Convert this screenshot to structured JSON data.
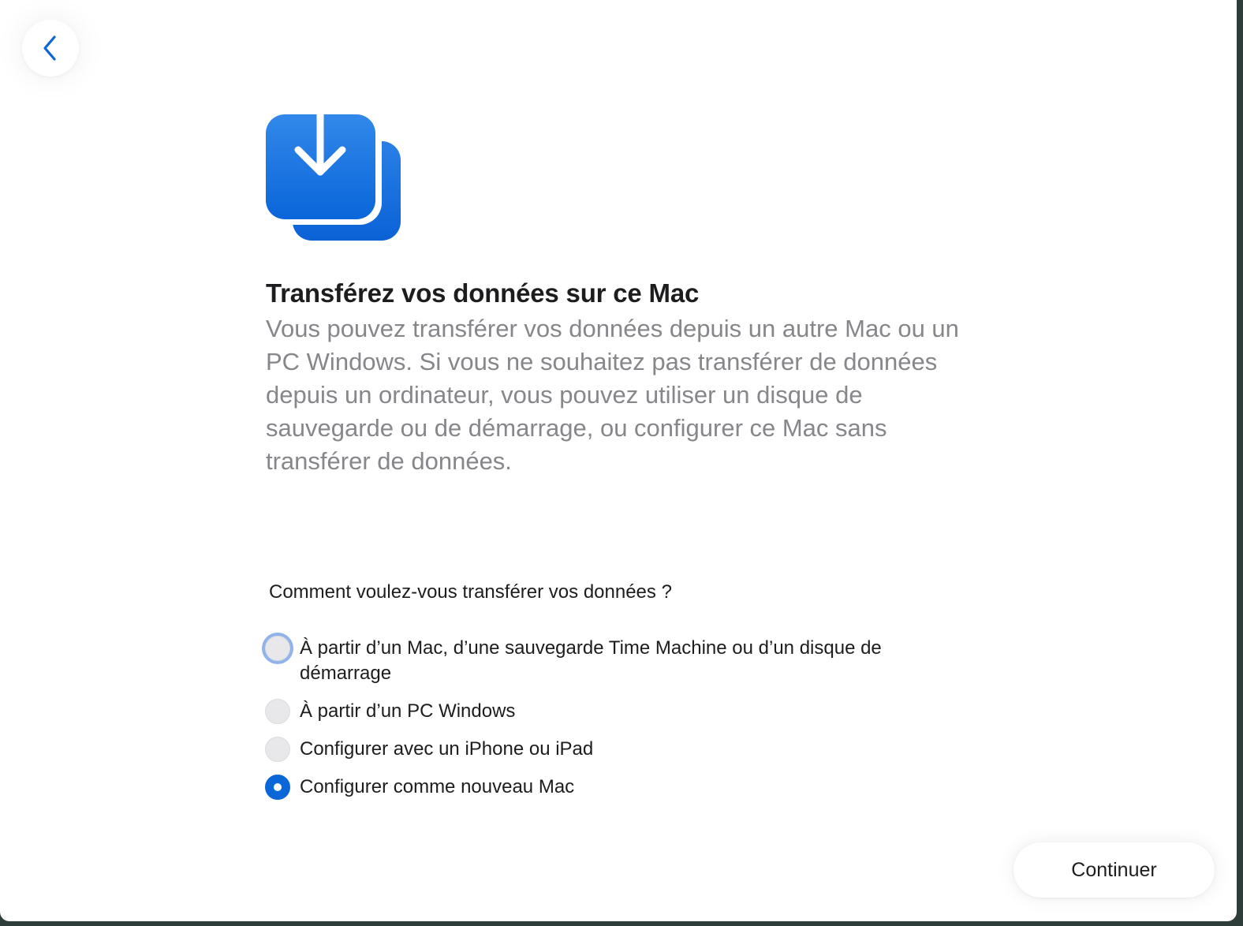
{
  "header": {
    "back_icon": "chevron-left-icon"
  },
  "hero": {
    "icon": "download-transfer-icon",
    "accent_color": "#0a67d8"
  },
  "main": {
    "title": "Transférez vos données sur ce Mac",
    "description": "Vous pouvez transférer vos données depuis un autre Mac ou un PC Windows. Si vous ne souhaitez pas transférer de données depuis un ordinateur, vous pouvez utiliser un disque de sauvegarde ou de démarrage, ou configurer ce Mac sans transférer de données.",
    "question": "Comment voulez-vous transférer vos données ?",
    "options": [
      {
        "label": "À partir d’un Mac, d’une sauvegarde Time Machine ou d’un disque de démarrage",
        "selected": false,
        "focused": true
      },
      {
        "label": "À partir d’un PC Windows",
        "selected": false,
        "focused": false
      },
      {
        "label": "Configurer avec un iPhone ou iPad",
        "selected": false,
        "focused": false
      },
      {
        "label": "Configurer comme nouveau Mac",
        "selected": true,
        "focused": false
      }
    ]
  },
  "footer": {
    "continue_label": "Continuer"
  }
}
